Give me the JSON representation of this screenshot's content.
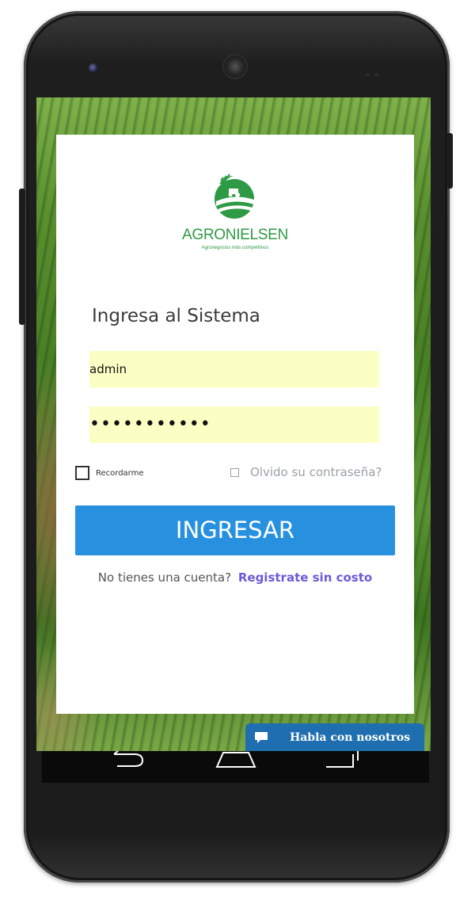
{
  "logo": {
    "name": "AGRONIELSEN",
    "tagline": "Agronegocios más competitivos",
    "color": "#2e9a45"
  },
  "form": {
    "title": "Ingresa al Sistema",
    "username_value": "admin",
    "password_value": "•••••••••••",
    "remember_label": "Recordarme",
    "forgot_label": "Olvido su contraseña?",
    "submit_label": "INGRESAR",
    "signup_prompt": "No tienes una cuenta?",
    "signup_link": "Registrate sin costo"
  },
  "chat": {
    "label": "Habla con nosotros",
    "icon": "chat-bubble-icon"
  },
  "colors": {
    "input_bg": "#fbffc3",
    "button": "#2791e0",
    "link": "#6c5bd8",
    "chat": "#1f6fb0"
  }
}
